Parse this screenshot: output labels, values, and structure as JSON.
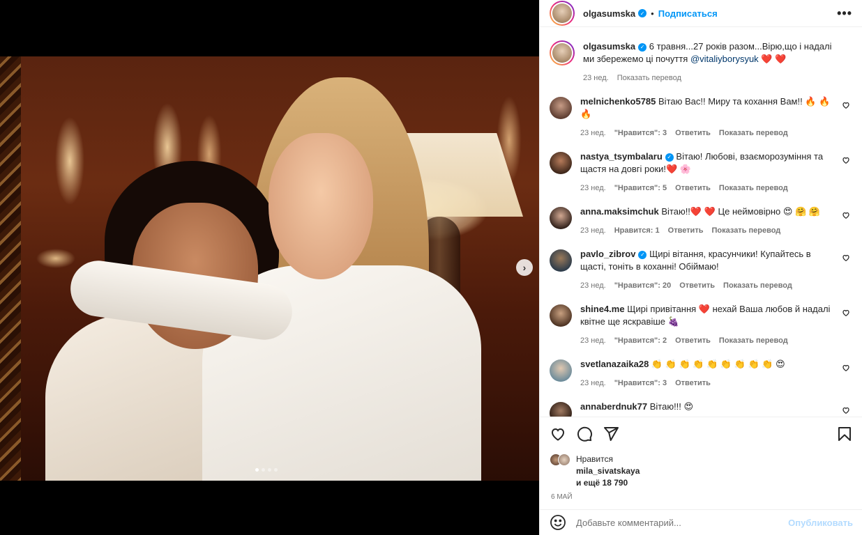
{
  "post": {
    "author": "olgasumska",
    "follow_label": "Подписаться",
    "more_label": "•••",
    "separator": "•"
  },
  "caption": {
    "username": "olgasumska",
    "text": "6 травня...27 років разом...Вірю,що і надалі ми збережемо ці почуття",
    "mention": "@vitaliyborysyuk",
    "emoji": "❤️ ❤️",
    "time": "23 нед.",
    "translate": "Показать перевод"
  },
  "comments": [
    {
      "username": "melnichenko5785",
      "verified": false,
      "text": "Вітаю Вас!! Миру та кохання Вам!! 🔥 🔥 🔥",
      "time": "23 нед.",
      "likes": "\"Нравится\": 3",
      "reply": "Ответить",
      "translate": "Показать перевод"
    },
    {
      "username": "nastya_tsymbalaru",
      "verified": true,
      "text": "Вітаю! Любові, взаєморозуміння та щастя на довгі роки!❤️ 🌸",
      "time": "23 нед.",
      "likes": "\"Нравится\": 5",
      "reply": "Ответить",
      "translate": "Показать перевод"
    },
    {
      "username": "anna.maksimchuk",
      "verified": false,
      "text": "Вітаю!!❤️ ❤️  Це неймовірно 😍 🤗 🤗",
      "time": "23 нед.",
      "likes": "Нравится: 1",
      "reply": "Ответить",
      "translate": "Показать перевод"
    },
    {
      "username": "pavlo_zibrov",
      "verified": true,
      "text": "Щирі вітання, красунчики! Купайтесь в щасті, тоніть в коханні! Обіймаю!",
      "time": "23 нед.",
      "likes": "\"Нравится\": 20",
      "reply": "Ответить",
      "translate": "Показать перевод"
    },
    {
      "username": "shine4.me",
      "verified": false,
      "text": "Щирі привітання ❤️  нехай Ваша любов й надалі квітне ще яскравіше 🍇",
      "time": "23 нед.",
      "likes": "\"Нравится\": 2",
      "reply": "Ответить",
      "translate": "Показать перевод"
    },
    {
      "username": "svetlanazaika28",
      "verified": false,
      "text": "👏 👏 👏 👏 👏 👏 👏 👏 👏 😍",
      "time": "23 нед.",
      "likes": "\"Нравится\": 3",
      "reply": "Ответить",
      "translate": ""
    },
    {
      "username": "annaberdnuk77",
      "verified": false,
      "text": "Вітаю!!! 😍",
      "time": "",
      "likes": "",
      "reply": "",
      "translate": ""
    }
  ],
  "likes": {
    "label": "Нравится",
    "user": "mila_sivatskaya",
    "others": "и ещё 18 790"
  },
  "date": "6 МАЙ",
  "add_comment": {
    "placeholder": "Добавьте комментарий...",
    "publish": "Опубликовать"
  },
  "carousel": {
    "slides": 4,
    "current": 1,
    "next_icon": "chevron-right-icon"
  },
  "colors": {
    "accent": "#0095f6",
    "publish_disabled": "#b3dbff",
    "like_red": "#ed4956",
    "secondary_text": "#737373"
  }
}
